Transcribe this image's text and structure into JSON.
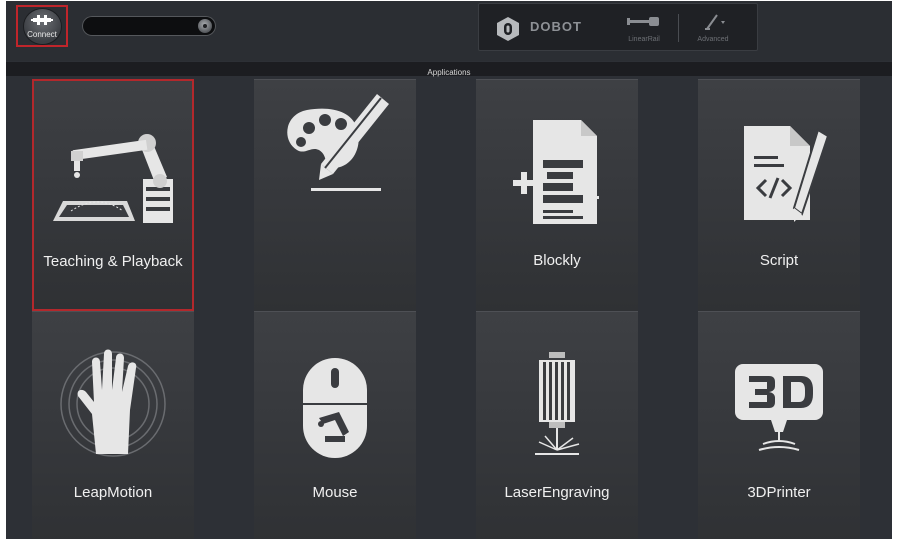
{
  "toolbar": {
    "connect_label": "Connect",
    "port_value": "",
    "brand": "DOBOT",
    "rail_label": "LinearRail",
    "advanced_label": "Advanced"
  },
  "section": {
    "title": "Applications"
  },
  "tiles": [
    {
      "label": "Teaching & Playback",
      "icon": "robot-arm-icon",
      "selected": true
    },
    {
      "label": "",
      "icon": "palette-pencil-icon",
      "selected": false
    },
    {
      "label": "Blockly",
      "icon": "blockly-document-icon",
      "selected": false
    },
    {
      "label": "Script",
      "icon": "script-document-icon",
      "selected": false
    },
    {
      "label": "LeapMotion",
      "icon": "hand-icon",
      "selected": false
    },
    {
      "label": "Mouse",
      "icon": "mouse-icon",
      "selected": false
    },
    {
      "label": "LaserEngraving",
      "icon": "laser-icon",
      "selected": false
    },
    {
      "label": "3DPrinter",
      "icon": "3d-printer-icon",
      "selected": false
    }
  ],
  "colors": {
    "background": "#2d3036",
    "tile": "#3a3c40",
    "selection": "#b3282c",
    "icon": "#e6e6e6"
  }
}
